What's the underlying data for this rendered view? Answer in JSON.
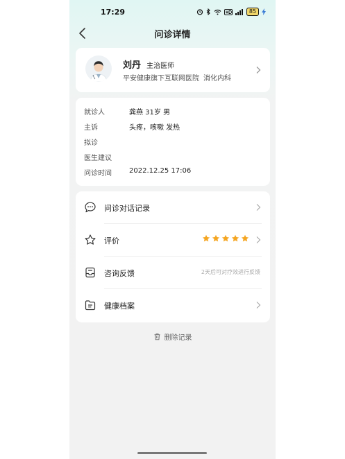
{
  "status_bar": {
    "time": "17:29",
    "battery": "85"
  },
  "header": {
    "title": "问诊详情"
  },
  "doctor": {
    "name": "刘丹",
    "title": "主治医师",
    "hospital": "平安健康旗下互联网医院",
    "department": "消化内科"
  },
  "consultation": {
    "rows": [
      {
        "label": "就诊人",
        "value": "龚燕  31岁  男"
      },
      {
        "label": "主诉",
        "value": "头疼，咳嗽 发热"
      },
      {
        "label": "拟诊",
        "value": ""
      },
      {
        "label": "医生建议",
        "value": ""
      },
      {
        "label": "问诊时间",
        "value": "2022.12.25   17:06"
      }
    ]
  },
  "menu": {
    "items": [
      {
        "label": "问诊对话记录",
        "icon": "chat-record-icon"
      },
      {
        "label": "评价",
        "icon": "star-outline-icon",
        "rating": 5
      },
      {
        "label": "咨询反馈",
        "icon": "feedback-icon",
        "hint": "2天后可对疗效进行反馈"
      },
      {
        "label": "健康档案",
        "icon": "folder-icon"
      }
    ]
  },
  "actions": {
    "delete_label": "删除记录"
  },
  "colors": {
    "star": "#f5a623",
    "header_bg": "#e0f6f3",
    "page_bg": "#f2f2f2"
  }
}
